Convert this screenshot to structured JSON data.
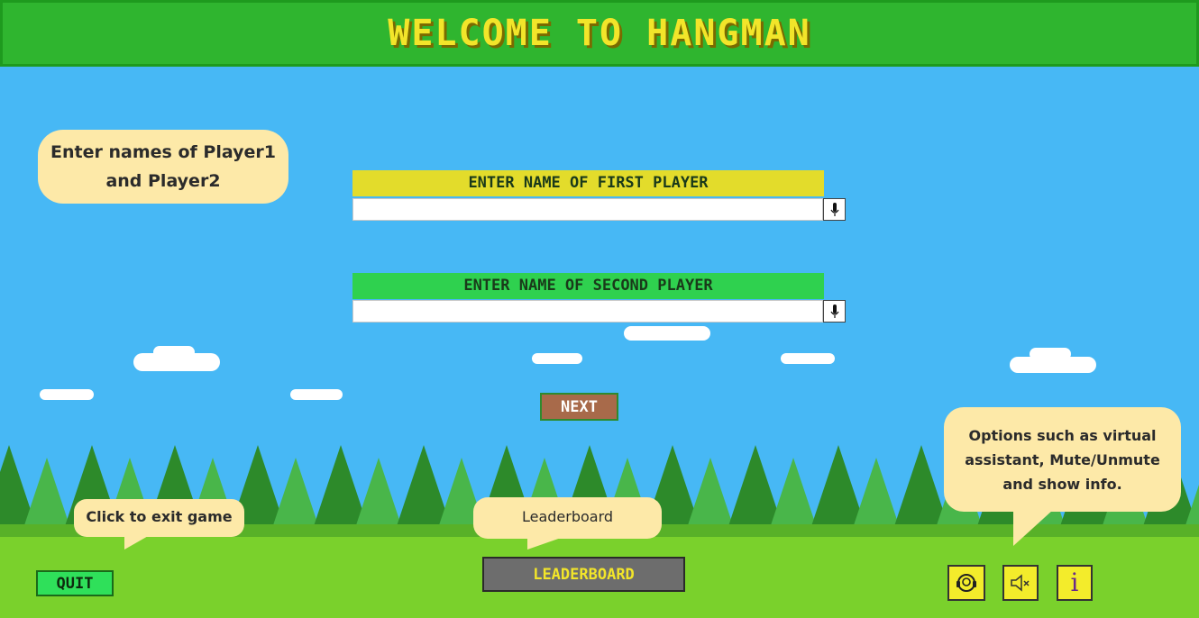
{
  "header": {
    "title": "WELCOME TO HANGMAN"
  },
  "tips": {
    "names": "Enter names of Player1 and Player2",
    "quit": "Click to exit game",
    "leaderboard": "Leaderboard",
    "options": "Options such as virtual assistant, Mute/Unmute and show info."
  },
  "form": {
    "first_label": "ENTER NAME OF FIRST PLAYER",
    "second_label": "ENTER NAME OF SECOND PLAYER",
    "first_value": "",
    "second_value": "",
    "next_label": "NEXT"
  },
  "footer": {
    "quit_label": "QUIT",
    "leaderboard_label": "LEADERBOARD",
    "info_glyph": "i"
  },
  "icons": [
    "assistant-icon",
    "mute-icon",
    "info-icon",
    "mic-icon"
  ],
  "colors": {
    "sky": "#47b8f5",
    "title_bar": "#2fb52f",
    "title_text": "#f2e52a",
    "first_label": "#e3dc2b",
    "second_label": "#2fd14f",
    "grass": "#7ad12c"
  }
}
